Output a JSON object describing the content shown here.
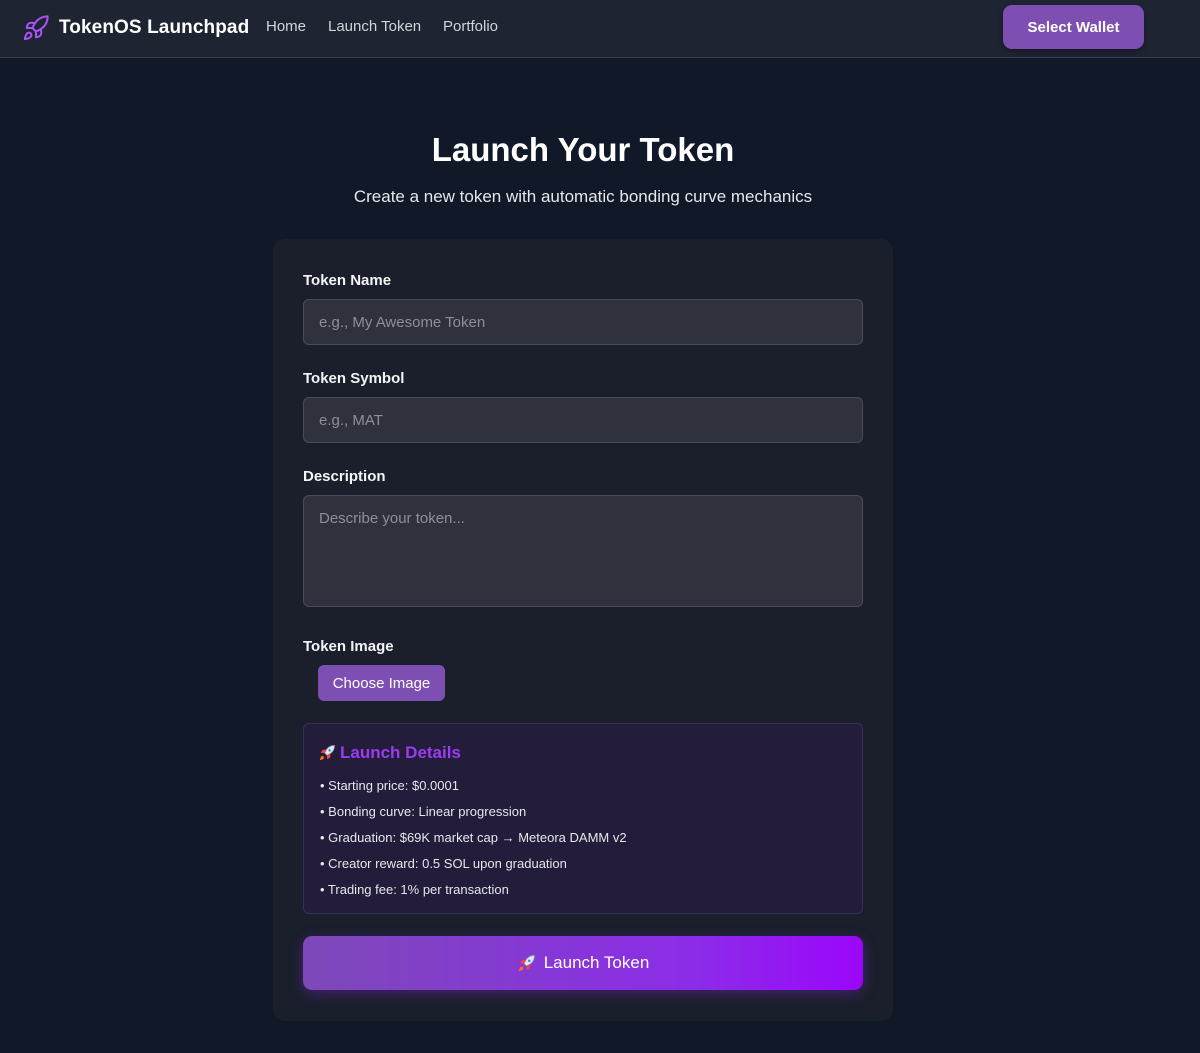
{
  "header": {
    "brand_name": "TokenOS Launchpad",
    "brand_icon": "rocket-icon",
    "nav": [
      {
        "label": "Home"
      },
      {
        "label": "Launch Token"
      },
      {
        "label": "Portfolio"
      }
    ],
    "wallet_button": "Select Wallet"
  },
  "main": {
    "title": "Launch Your Token",
    "subtitle": "Create a new token with automatic bonding curve mechanics"
  },
  "form": {
    "name": {
      "label": "Token Name",
      "placeholder": "e.g., My Awesome Token",
      "value": ""
    },
    "symbol": {
      "label": "Token Symbol",
      "placeholder": "e.g., MAT",
      "value": ""
    },
    "description": {
      "label": "Description",
      "placeholder": "Describe your token...",
      "value": ""
    },
    "image": {
      "label": "Token Image",
      "button": "Choose Image"
    }
  },
  "details": {
    "title": "Launch Details",
    "icon": "rocket-icon",
    "items": [
      "• Starting price: $0.0001",
      "• Bonding curve: Linear progression",
      "• Graduation: $69K market cap → Meteora DAMM v2",
      "• Creator reward: 0.5 SOL upon graduation",
      "• Trading fee: 1% per transaction"
    ]
  },
  "launch_button": {
    "label": "Launch Token",
    "icon": "rocket-icon"
  },
  "colors": {
    "background": "#111827",
    "navbar": "#1f2432",
    "accent": "#7e4fb2",
    "details_title": "#9b3cf0",
    "launch_gradient_end": "#9b06fa"
  }
}
